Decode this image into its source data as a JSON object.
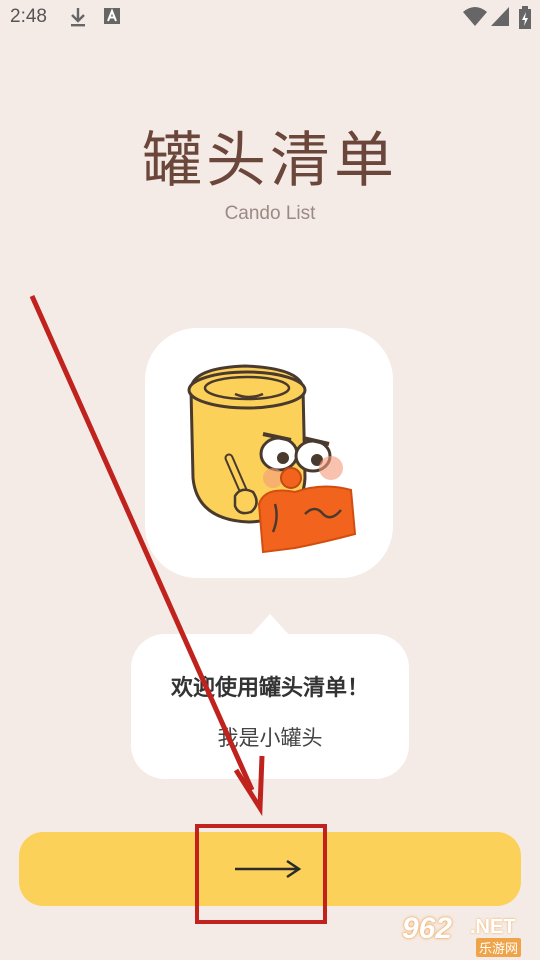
{
  "status_bar": {
    "time": "2:48",
    "icons": [
      "download-icon",
      "font-a-icon",
      "wifi-icon",
      "signal-icon",
      "battery-icon"
    ]
  },
  "header": {
    "title": "罐头清单",
    "subtitle": "Cando List"
  },
  "mascot": {
    "name": "mascot-jar-illustration"
  },
  "bubble": {
    "title": "欢迎使用罐头清单！",
    "text": "我是小罐头"
  },
  "next_button": {
    "icon": "long-arrow-right-icon"
  },
  "watermark": {
    "number": "962",
    "suffix": ".NET",
    "sub": "乐游网"
  },
  "colors": {
    "background": "#f5ebe6",
    "accent": "#fcd15a",
    "title": "#6b463a",
    "annotation": "#c0231d"
  }
}
